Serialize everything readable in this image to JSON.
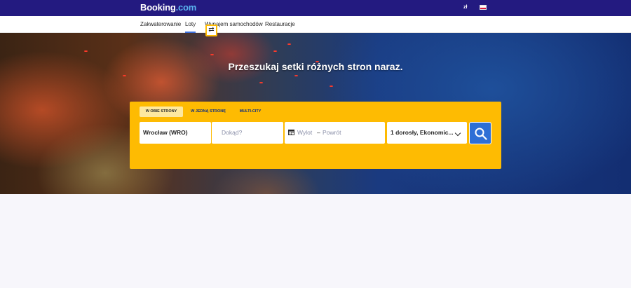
{
  "header": {
    "logo_main": "Booking",
    "logo_suffix": ".com",
    "currency": "zł",
    "language_flag": "flag-pl-icon"
  },
  "nav": {
    "items": [
      {
        "label": "Zakwaterowanie",
        "active": false
      },
      {
        "label": "Loty",
        "active": true
      },
      {
        "label": "Wynajem samochodów",
        "active": false
      },
      {
        "label": "Restauracje",
        "active": false
      }
    ]
  },
  "hero": {
    "title": "Przeszukaj setki różnych stron naraz."
  },
  "search": {
    "trip_types": [
      {
        "label": "W OBIE STRONY",
        "active": true
      },
      {
        "label": "W JEDNĄ STRONĘ",
        "active": false
      },
      {
        "label": "MULTI-CITY",
        "active": false
      }
    ],
    "from_value": "Wrocław (WRO)",
    "to_placeholder": "Dokąd?",
    "departure_placeholder": "Wylot",
    "date_separator": "–",
    "return_placeholder": "Powrót",
    "passengers_value": "1 dorosły, Ekonomic...",
    "search_icon": "search-icon",
    "swap_icon": "swap-icon"
  },
  "colors": {
    "header_bg": "#231a80",
    "search_box": "#febb02",
    "search_button": "#2e6fd6"
  }
}
